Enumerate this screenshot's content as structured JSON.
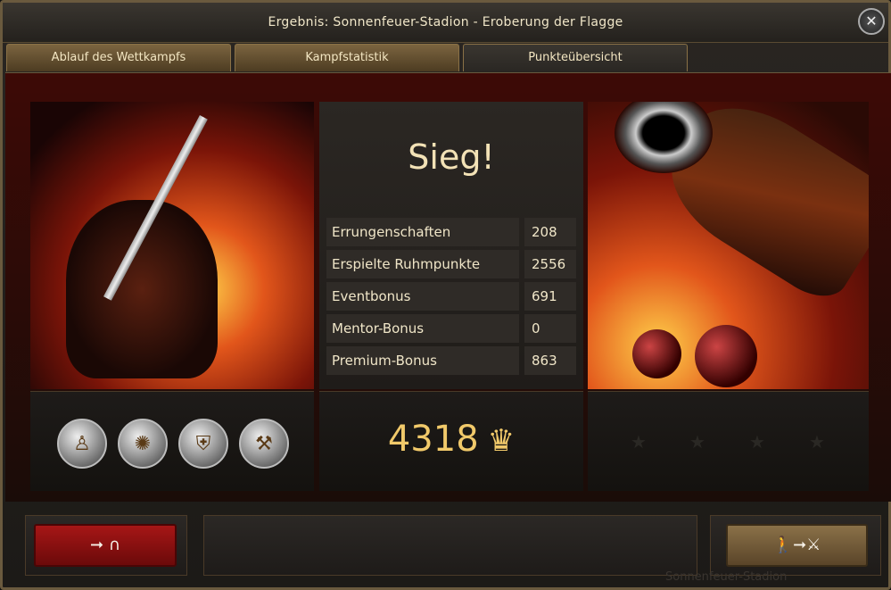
{
  "window": {
    "title": "Ergebnis:  Sonnenfeuer-Stadion  -  Eroberung  der  Flagge",
    "close_symbol": "✕"
  },
  "tabs": [
    {
      "label": "Ablauf  des  Wettkampfs",
      "active": false
    },
    {
      "label": "Kampfstatistik",
      "active": false
    },
    {
      "label": "Punkteübersicht",
      "active": true
    }
  ],
  "result": {
    "headline": "Sieg!"
  },
  "stats": [
    {
      "label": "Errungenschaften",
      "value": "208"
    },
    {
      "label": "Erspielte  Ruhmpunkte",
      "value": "2556"
    },
    {
      "label": "Eventbonus",
      "value": "691"
    },
    {
      "label": "Mentor-Bonus",
      "value": "0"
    },
    {
      "label": "Premium-Bonus",
      "value": "863"
    }
  ],
  "total": {
    "value": "4318",
    "icon": "crown-icon",
    "glyph": "♛"
  },
  "medals": [
    {
      "icon": "pillar-medal-icon",
      "glyph": "♙"
    },
    {
      "icon": "dragon-medal-icon",
      "glyph": "✺"
    },
    {
      "icon": "shield-medal-icon",
      "glyph": "⛨"
    },
    {
      "icon": "crossed-tools-medal-icon",
      "glyph": "⚒"
    }
  ],
  "stars": {
    "glyph": "★",
    "count": 4
  },
  "footer": {
    "exit_label": "➞ ∩",
    "join_label": "🚶➞⚔",
    "watermark": "Sonnenfeuer-Stadion"
  },
  "colors": {
    "accent_gold": "#f1c96a",
    "exit_red": "#a61616",
    "tab_brown": "#7b6440"
  }
}
